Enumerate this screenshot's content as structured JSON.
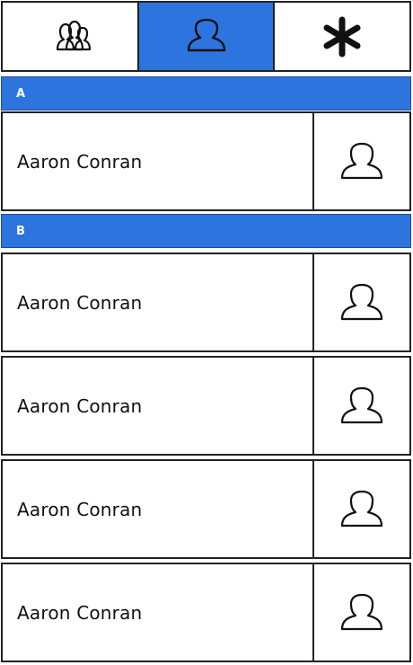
{
  "tabs": [
    {
      "id": "groups",
      "icon": "users-icon",
      "active": false
    },
    {
      "id": "contacts",
      "icon": "user-icon",
      "active": true
    },
    {
      "id": "favorites",
      "icon": "asterisk-icon",
      "active": false
    }
  ],
  "colors": {
    "accent": "#2d74df",
    "border": "#222222",
    "text": "#111111",
    "header_text": "#ffffff"
  },
  "sections": [
    {
      "letter": "A",
      "contacts": [
        {
          "name": "Aaron Conran",
          "icon": "user-icon"
        }
      ]
    },
    {
      "letter": "B",
      "contacts": [
        {
          "name": "Aaron Conran",
          "icon": "user-icon"
        },
        {
          "name": "Aaron Conran",
          "icon": "user-icon"
        },
        {
          "name": "Aaron Conran",
          "icon": "user-icon"
        },
        {
          "name": "Aaron Conran",
          "icon": "user-icon"
        }
      ]
    }
  ]
}
